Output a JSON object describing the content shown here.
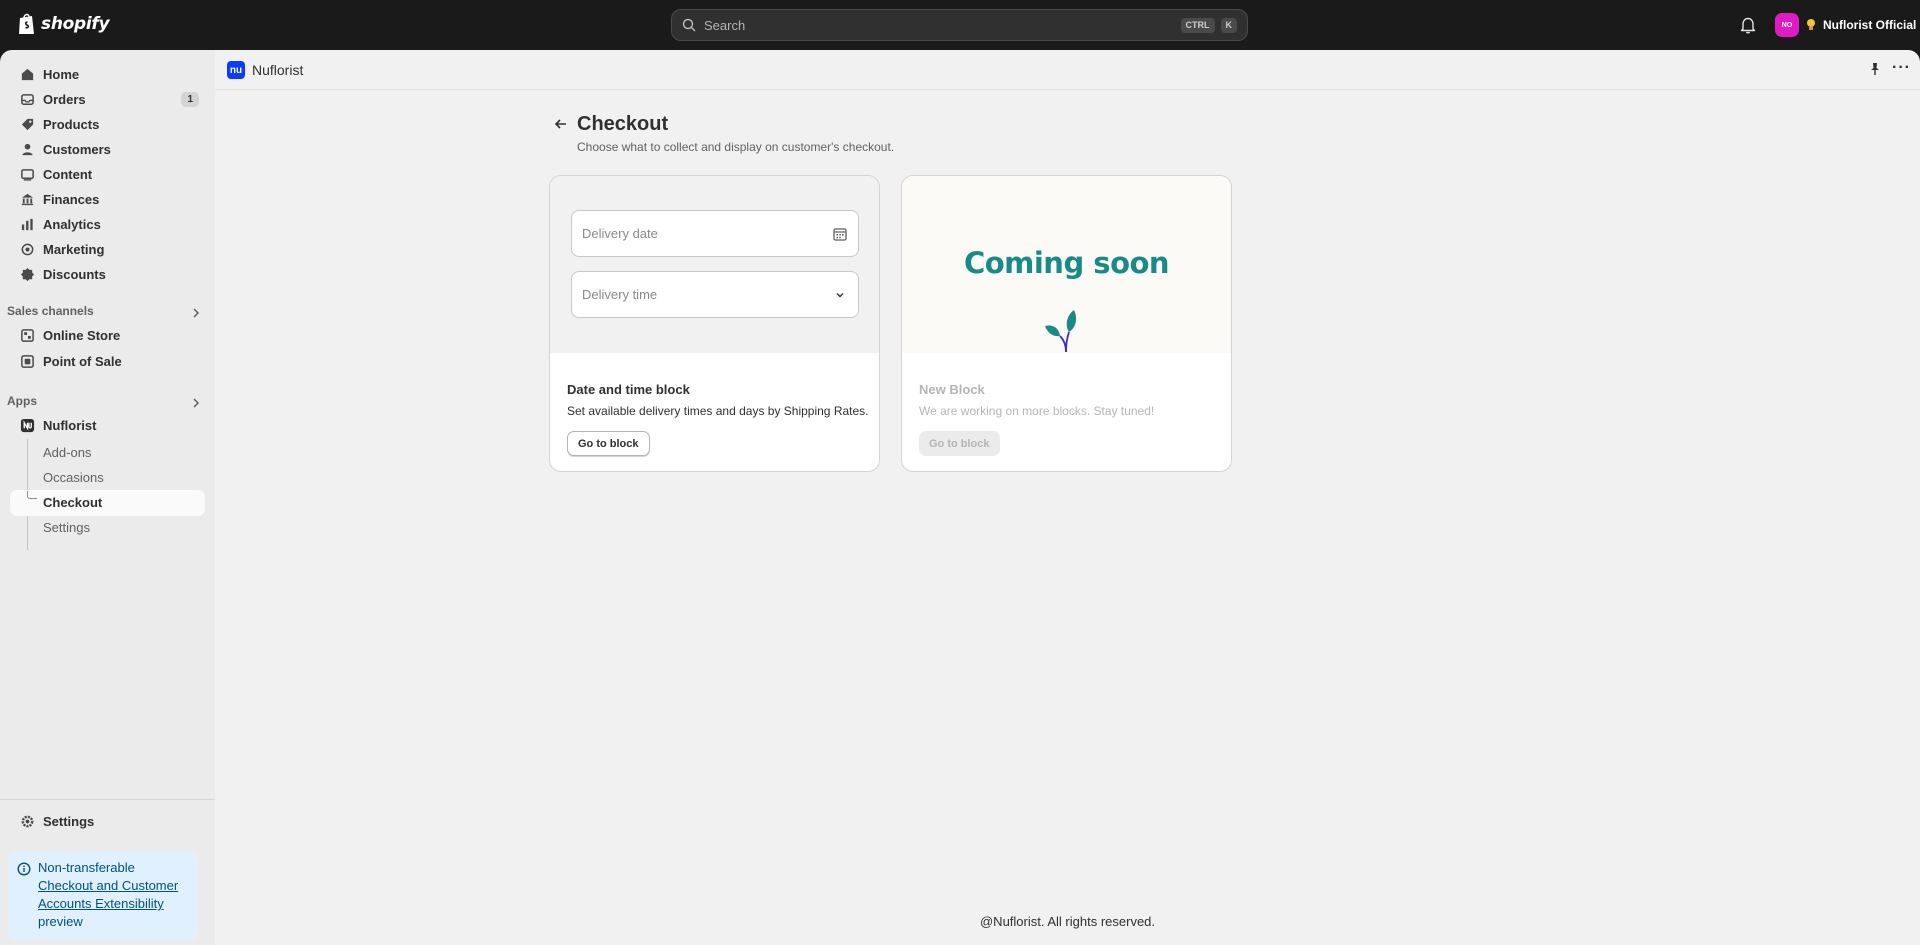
{
  "topbar": {
    "brand": "shopify",
    "search_placeholder": "Search",
    "shortcut_ctrl": "CTRL",
    "shortcut_k": "K",
    "avatar_initials": "NO",
    "account_name": "Nuflorist Official"
  },
  "sidebar": {
    "items": [
      {
        "label": "Home",
        "icon": "home-icon"
      },
      {
        "label": "Orders",
        "icon": "inbox-icon",
        "badge": "1"
      },
      {
        "label": "Products",
        "icon": "tag-icon"
      },
      {
        "label": "Customers",
        "icon": "person-icon"
      },
      {
        "label": "Content",
        "icon": "content-icon"
      },
      {
        "label": "Finances",
        "icon": "bank-icon"
      },
      {
        "label": "Analytics",
        "icon": "chart-icon"
      },
      {
        "label": "Marketing",
        "icon": "target-icon"
      },
      {
        "label": "Discounts",
        "icon": "discount-icon"
      }
    ],
    "sales_channels_title": "Sales channels",
    "sales_channels": [
      {
        "label": "Online Store",
        "icon": "store-icon"
      },
      {
        "label": "Point of Sale",
        "icon": "pos-icon"
      }
    ],
    "apps_title": "Apps",
    "app_name": "Nuflorist",
    "app_sub_items": [
      "Add-ons",
      "Occasions",
      "Checkout",
      "Settings"
    ],
    "settings_label": "Settings",
    "banner": {
      "prefix": "Non-transferable",
      "link": "Checkout and Customer Accounts Extensibility",
      "suffix": "preview"
    }
  },
  "main": {
    "app_title": "Nuflorist",
    "page_title": "Checkout",
    "page_subtitle": "Choose what to collect and display on customer's checkout.",
    "cards": [
      {
        "field_1": "Delivery date",
        "field_2": "Delivery time",
        "title": "Date and time block",
        "description": "Set available delivery times and days by Shipping Rates.",
        "button": "Go to block"
      },
      {
        "hero": "Coming soon",
        "title": "New Block",
        "description": "We are working on more blocks. Stay tuned!",
        "button": "Go to block"
      }
    ],
    "footer": "@Nuflorist. All rights reserved."
  },
  "colors": {
    "topbar_bg": "#1a1a1a",
    "accent_teal": "#1a8a86",
    "app_logo_blue": "#0a3cff",
    "avatar_pink": "#e11bc3",
    "banner_bg": "#e0f0ff"
  }
}
